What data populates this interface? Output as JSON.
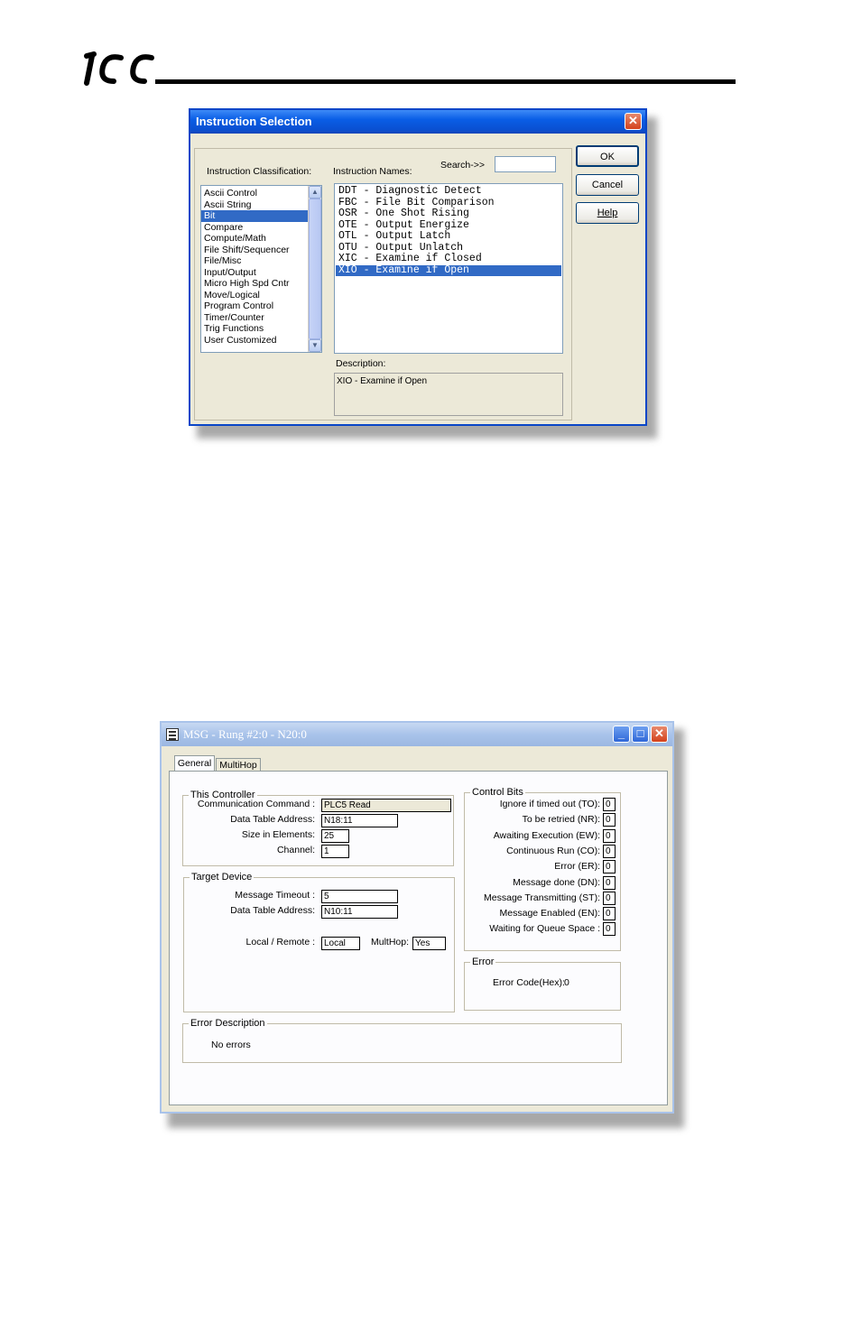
{
  "header": {
    "logo_alt": "ICC"
  },
  "instruction_dialog": {
    "title": "Instruction Selection",
    "close_label": "✕",
    "classification_label": "Instruction Classification:",
    "names_label": "Instruction Names:",
    "search_label": "Search->>",
    "search_value": "",
    "classifications": [
      "Ascii Control",
      "Ascii String",
      "Bit",
      "Compare",
      "Compute/Math",
      "File Shift/Sequencer",
      "File/Misc",
      "Input/Output",
      "Micro High Spd Cntr",
      "Move/Logical",
      "Program Control",
      "Timer/Counter",
      "Trig Functions",
      "User Customized"
    ],
    "selected_classification": "Bit",
    "instructions": [
      "DDT - Diagnostic Detect",
      "FBC - File Bit Comparison",
      "OSR - One Shot Rising",
      "OTE - Output Energize",
      "OTL - Output Latch",
      "OTU - Output Unlatch",
      "XIC - Examine if Closed",
      "XIO - Examine if Open"
    ],
    "selected_instruction": "XIO - Examine if Open",
    "description_label": "Description:",
    "description_text": "XIO - Examine if Open",
    "ok_label": "OK",
    "cancel_label": "Cancel",
    "help_label": "Help"
  },
  "msg_dialog": {
    "title": "MSG - Rung #2:0 - N20:0",
    "tabs": [
      "General",
      "MultiHop"
    ],
    "active_tab": "General",
    "this_controller": {
      "legend": "This Controller",
      "comm_command_label": "Communication Command :",
      "comm_command_value": "PLC5 Read",
      "data_table_label": "Data Table Address:",
      "data_table_value": "N18:11",
      "size_label": "Size in Elements:",
      "size_value": "25",
      "channel_label": "Channel:",
      "channel_value": "1"
    },
    "target_device": {
      "legend": "Target Device",
      "timeout_label": "Message Timeout :",
      "timeout_value": "5",
      "data_table_label": "Data Table Address:",
      "data_table_value": "N10:11",
      "local_remote_label": "Local / Remote :",
      "local_remote_value": "Local",
      "multihop_label": "MultHop:",
      "multihop_value": "Yes"
    },
    "control_bits": {
      "legend": "Control Bits",
      "items": [
        {
          "label": "Ignore if timed out (TO):",
          "value": "0"
        },
        {
          "label": "To be retried (NR):",
          "value": "0"
        },
        {
          "label": "Awaiting Execution (EW):",
          "value": "0"
        },
        {
          "label": "Continuous Run (CO):",
          "value": "0"
        },
        {
          "label": "Error (ER):",
          "value": "0"
        },
        {
          "label": "Message done (DN):",
          "value": "0"
        },
        {
          "label": "Message Transmitting (ST):",
          "value": "0"
        },
        {
          "label": "Message Enabled (EN):",
          "value": "0"
        },
        {
          "label": "Waiting for Queue Space :",
          "value": "0"
        }
      ]
    },
    "error": {
      "legend": "Error",
      "code_label": "Error Code(Hex):",
      "code_value": "0"
    },
    "error_description": {
      "legend": "Error Description",
      "text": "No errors"
    }
  }
}
